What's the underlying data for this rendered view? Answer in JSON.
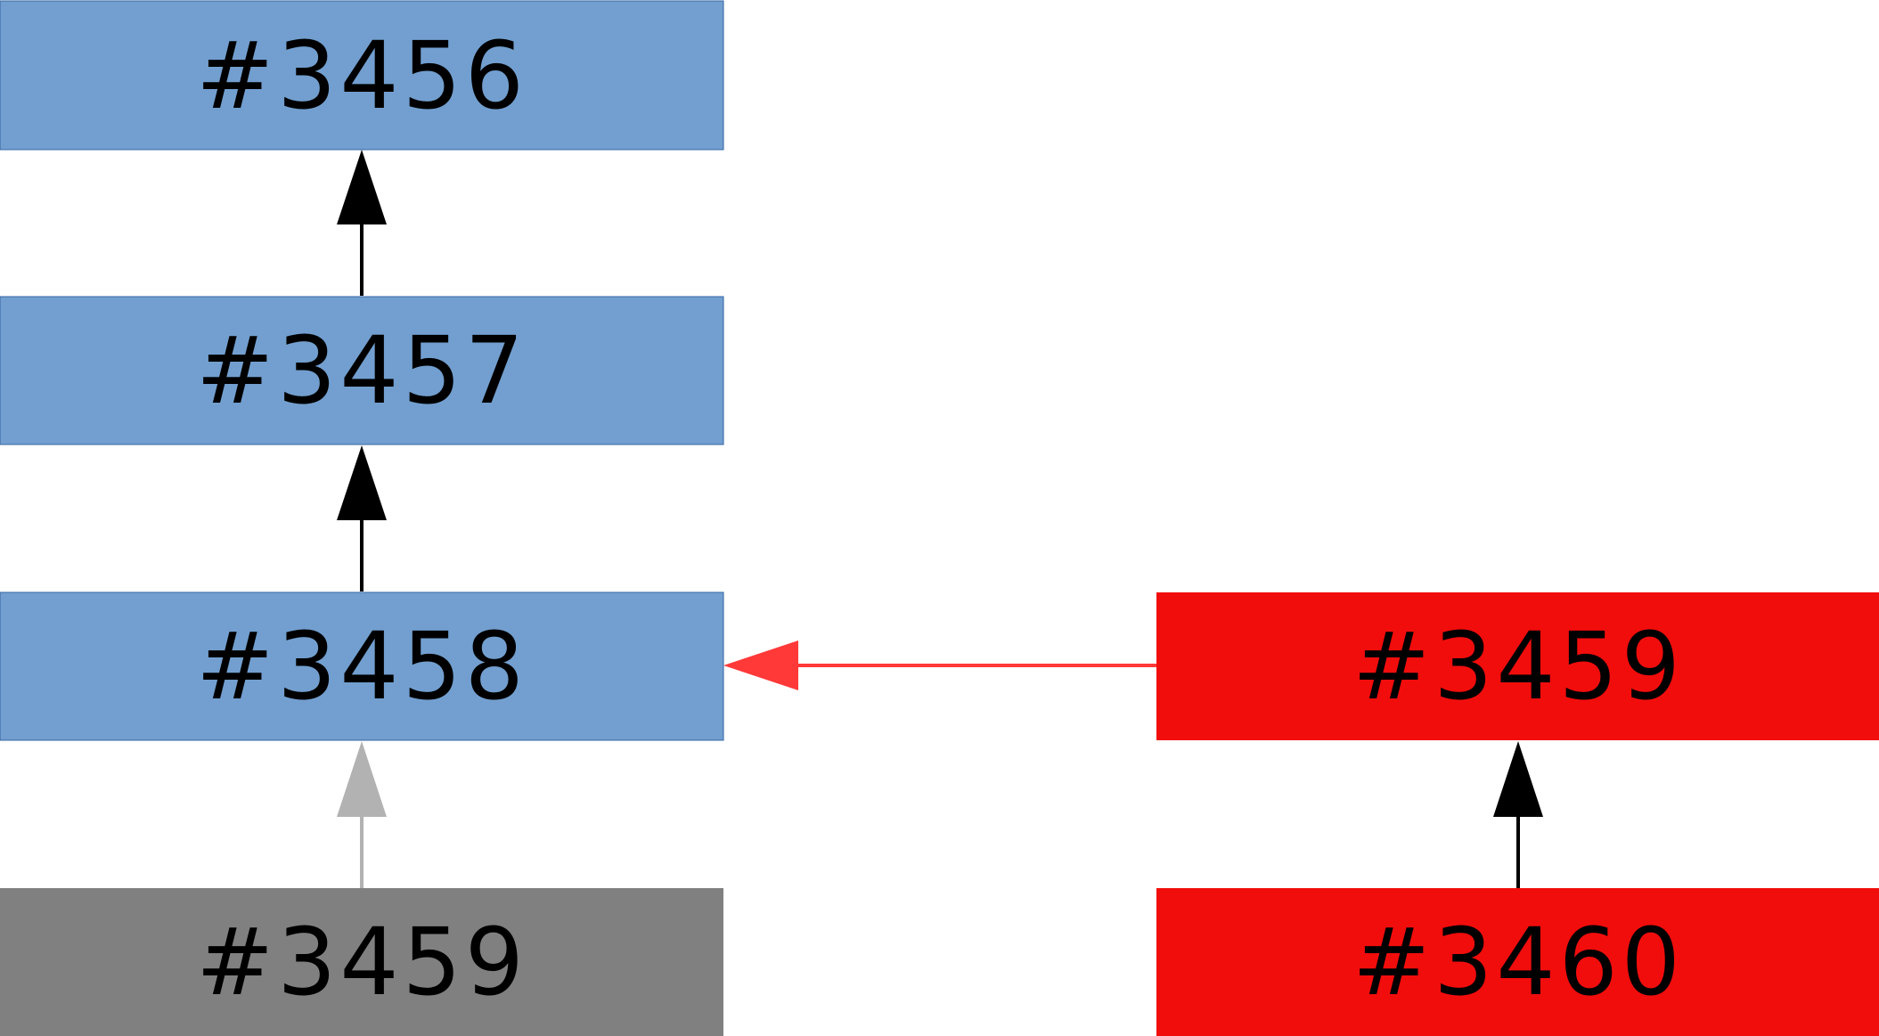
{
  "nodes": [
    {
      "id": "n3456",
      "label": "#3456",
      "status": "normal"
    },
    {
      "id": "n3457",
      "label": "#3457",
      "status": "normal"
    },
    {
      "id": "n3458",
      "label": "#3458",
      "status": "normal"
    },
    {
      "id": "n3459-gray",
      "label": "#3459",
      "status": "inactive"
    },
    {
      "id": "n3459-red",
      "label": "#3459",
      "status": "error"
    },
    {
      "id": "n3460",
      "label": "#3460",
      "status": "error"
    }
  ],
  "edges": [
    {
      "from": "n3457",
      "to": "n3456",
      "style": "normal"
    },
    {
      "from": "n3458",
      "to": "n3457",
      "style": "normal"
    },
    {
      "from": "n3459-gray",
      "to": "n3458",
      "style": "inactive"
    },
    {
      "from": "n3459-red",
      "to": "n3458",
      "style": "error"
    },
    {
      "from": "n3460",
      "to": "n3459-red",
      "style": "normal"
    }
  ],
  "colors": {
    "normal_fill": "#729fcf",
    "normal_stroke": "#3465a4",
    "inactive_fill": "#808080",
    "error_fill": "#f10d0c",
    "edge_normal": "#000000",
    "edge_inactive": "#b2b2b2",
    "edge_error": "#ff3838"
  }
}
